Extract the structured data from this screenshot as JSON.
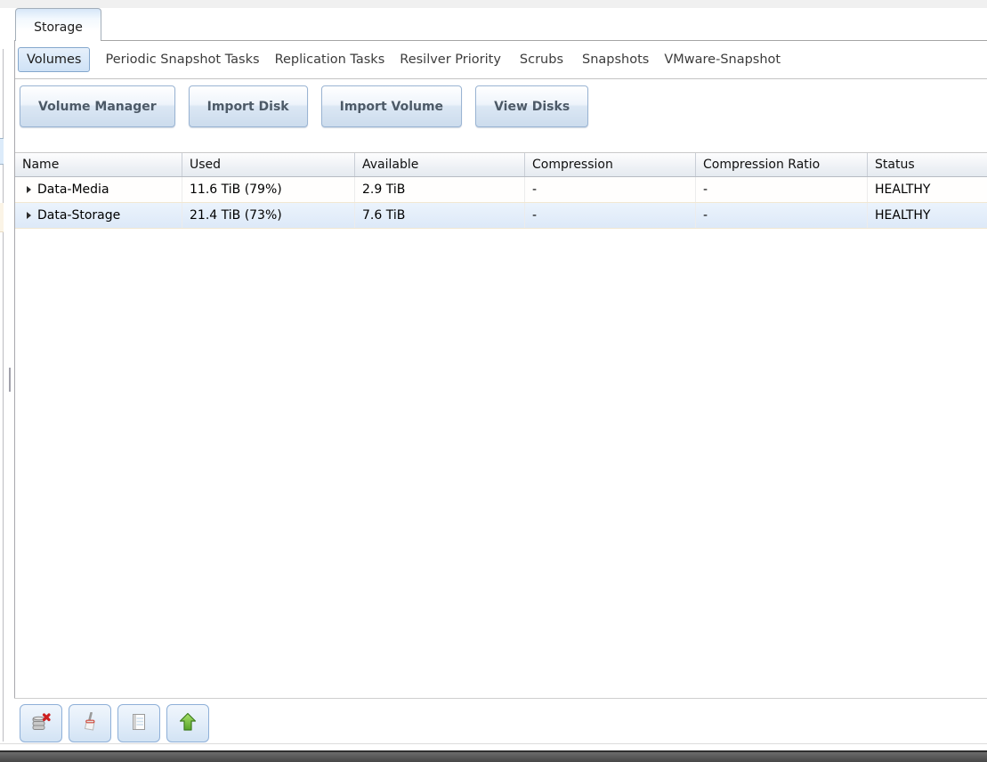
{
  "window": {
    "tab_title": "Storage"
  },
  "subtabs": {
    "items": [
      {
        "label": "Volumes",
        "active": true
      },
      {
        "label": "Periodic Snapshot Tasks",
        "active": false
      },
      {
        "label": "Replication Tasks",
        "active": false
      },
      {
        "label": "Resilver Priority",
        "active": false
      },
      {
        "label": "Scrubs",
        "active": false
      },
      {
        "label": "Snapshots",
        "active": false
      },
      {
        "label": "VMware-Snapshot",
        "active": false
      }
    ]
  },
  "actions": {
    "buttons": [
      {
        "label": "Volume Manager"
      },
      {
        "label": "Import Disk"
      },
      {
        "label": "Import Volume"
      },
      {
        "label": "View Disks"
      }
    ]
  },
  "grid": {
    "columns": [
      {
        "label": "Name"
      },
      {
        "label": "Used"
      },
      {
        "label": "Available"
      },
      {
        "label": "Compression"
      },
      {
        "label": "Compression Ratio"
      },
      {
        "label": "Status"
      }
    ],
    "rows": [
      {
        "name": "Data-Media",
        "used": "11.6 TiB (79%)",
        "available": "2.9 TiB",
        "compression": "-",
        "compression_ratio": "-",
        "status": "HEALTHY"
      },
      {
        "name": "Data-Storage",
        "used": "21.4 TiB (73%)",
        "available": "7.6 TiB",
        "compression": "-",
        "compression_ratio": "-",
        "status": "HEALTHY"
      }
    ]
  },
  "footer": {
    "buttons": [
      {
        "icon": "detach-volume-icon"
      },
      {
        "icon": "scrub-icon"
      },
      {
        "icon": "volume-status-icon"
      },
      {
        "icon": "upgrade-icon"
      }
    ]
  },
  "colors": {
    "active_subtab_bg": "#cfe2f6",
    "button_border": "#9ab4d3",
    "row_alt_bg": "#e4eefa",
    "healthy_status": "#000000",
    "dark_bar": "#474747",
    "upgrade_green": "#57a327",
    "detach_red": "#cc2020"
  }
}
